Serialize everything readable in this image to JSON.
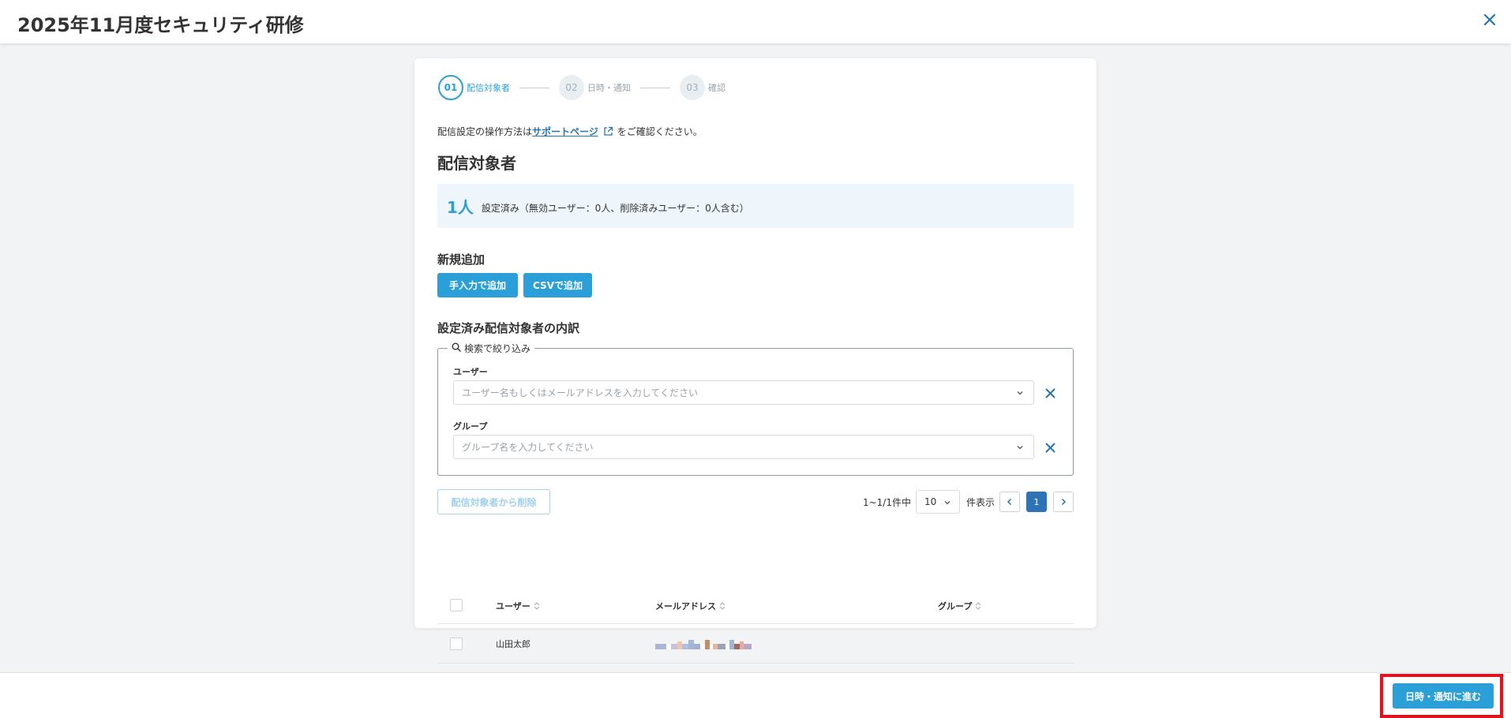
{
  "header": {
    "title": "2025年11月度セキュリティ研修",
    "close_icon": "close-icon"
  },
  "stepper": [
    {
      "number": "01",
      "label": "配信対象者",
      "state": "active"
    },
    {
      "number": "02",
      "label": "日時・通知",
      "state": "inactive"
    },
    {
      "number": "03",
      "label": "確認",
      "state": "inactive"
    }
  ],
  "intro": {
    "prefix": "配信設定の操作方法は",
    "link": "サポートページ",
    "suffix": "をご確認ください。"
  },
  "recipients": {
    "title": "配信対象者",
    "count": "1人",
    "count_desc": "設定済み（無効ユーザー：0人、削除済みユーザー：0人含む）"
  },
  "add": {
    "title": "新規追加",
    "manual_button": "手入力で追加",
    "csv_button": "CSVで追加"
  },
  "breakdown": {
    "title": "設定済み配信対象者の内訳",
    "filter_legend": "検索で絞り込み",
    "user_label": "ユーザー",
    "user_placeholder": "ユーザー名もしくはメールアドレスを入力してください",
    "group_label": "グループ",
    "group_placeholder": "グループ名を入力してください"
  },
  "actions": {
    "remove_button": "配信対象者から削除"
  },
  "pagination": {
    "range": "1~1/1件中",
    "per_page": "10",
    "per_page_unit": "件表示",
    "current_page": "1"
  },
  "table": {
    "columns": [
      "ユーザー",
      "メールアドレス",
      "グループ"
    ],
    "rows": [
      {
        "user": "山田太郎",
        "email": "",
        "group": ""
      }
    ]
  },
  "footer": {
    "next_button": "日時・通知に進む"
  },
  "colors": {
    "accent": "#2a9fd8",
    "page_active": "#2f73b7",
    "highlight": "#e0141e"
  }
}
